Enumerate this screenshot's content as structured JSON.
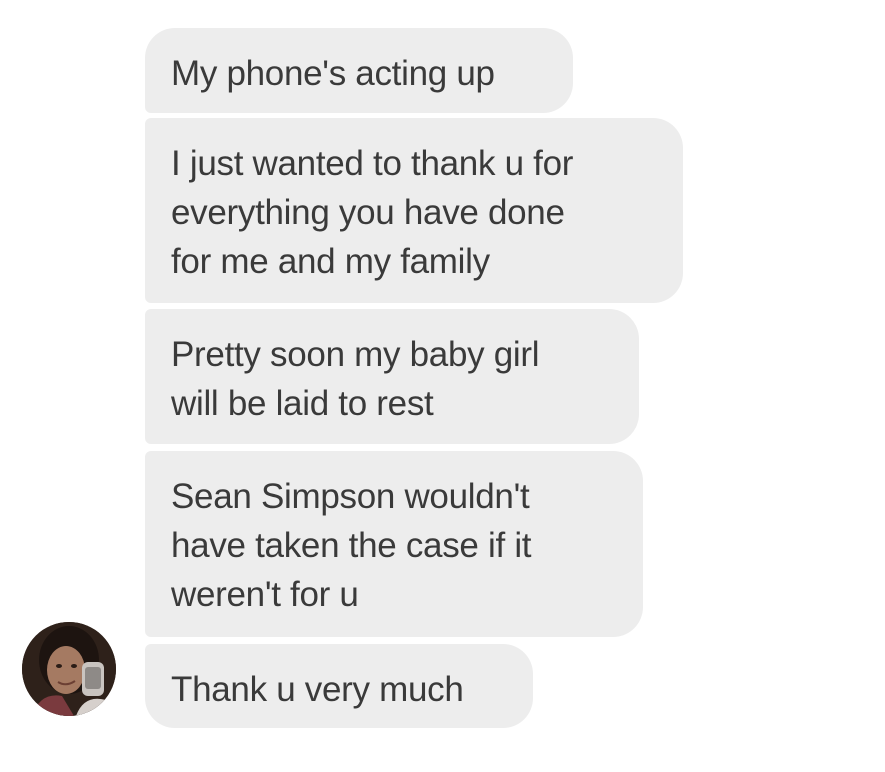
{
  "conversation": {
    "messages": [
      {
        "text": "My phone's acting up"
      },
      {
        "text": "I just wanted to thank u for\neverything you have done\nfor me and my family"
      },
      {
        "text": "Pretty soon my baby girl\nwill be laid to rest"
      },
      {
        "text": "Sean Simpson wouldn't\nhave taken the case if it\nweren't for u"
      },
      {
        "text": "Thank u very much"
      }
    ]
  },
  "sender": {
    "avatar_icon": "user-avatar-photo"
  },
  "colors": {
    "bubble_background": "#ededed",
    "bubble_text": "#3a3a3a",
    "page_background": "#ffffff"
  }
}
